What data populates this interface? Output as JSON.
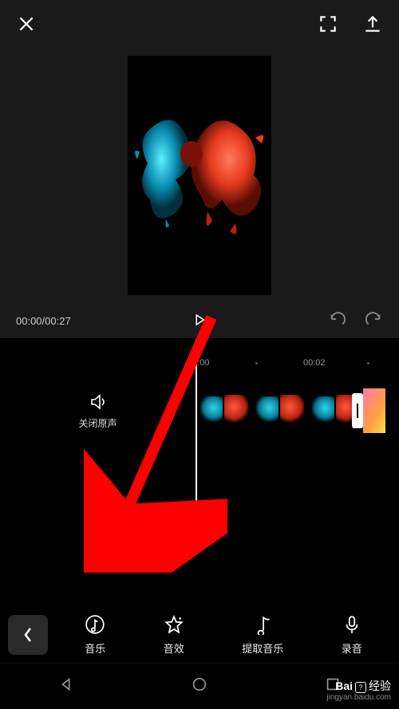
{
  "top": {
    "close": "close-icon",
    "fullscreen": "fullscreen-icon",
    "export": "export-icon"
  },
  "time": {
    "current": "00:00",
    "total": "00:27",
    "display": "00:00/00:27"
  },
  "ruler": {
    "t1": "00:00",
    "t2": "00:02"
  },
  "mute": {
    "label": "关闭原声"
  },
  "tools": {
    "music": "音乐",
    "effects": "音效",
    "extract": "提取音乐",
    "record": "录音"
  },
  "watermark": {
    "brand_prefix": "Bai",
    "brand_suffix": "经验",
    "url": "jingyan.baidu.com"
  }
}
